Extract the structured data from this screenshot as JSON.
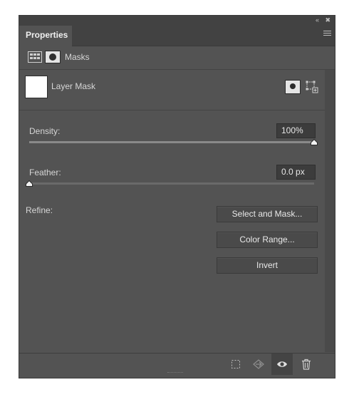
{
  "panel": {
    "tab_label": "Properties",
    "top_icons": [
      "collapse-icon",
      "close-icon"
    ],
    "menu_icon": "panel-menu-icon"
  },
  "section": {
    "label": "Masks",
    "icons": [
      "pixel-mask-icon",
      "vector-mask-icon"
    ]
  },
  "layer": {
    "label": "Layer Mask",
    "actions": [
      "add-pixel-mask-icon",
      "add-vector-mask-icon"
    ]
  },
  "density": {
    "label": "Density:",
    "value": "100%",
    "fraction": 1.0
  },
  "feather": {
    "label": "Feather:",
    "value": "0.0 px",
    "fraction": 0.0
  },
  "refine": {
    "label": "Refine:",
    "buttons": {
      "select_and_mask": "Select and Mask...",
      "color_range": "Color Range...",
      "invert": "Invert"
    }
  },
  "bottom_bar": {
    "icons": [
      "load-selection-icon",
      "apply-mask-icon",
      "visibility-eye-icon",
      "delete-trash-icon"
    ]
  },
  "colors": {
    "panel_bg": "#535353",
    "header_bg": "#424242",
    "text": "#d6d6d6",
    "field_bg": "#3c3c3c"
  }
}
